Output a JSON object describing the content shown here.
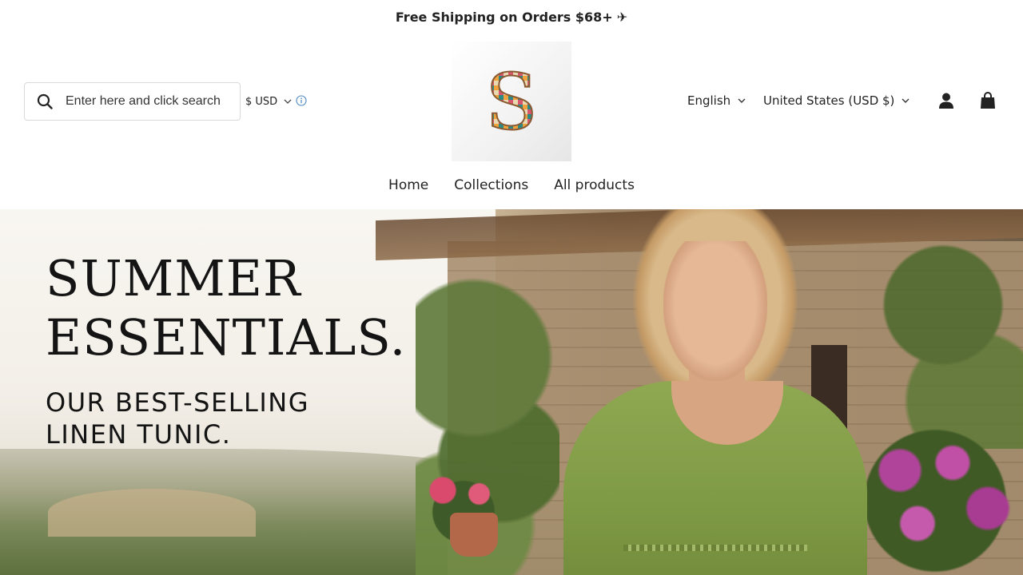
{
  "announcement": {
    "text": "Free Shipping on Orders $68+",
    "icon": "airplane-icon",
    "glyph": "✈"
  },
  "search": {
    "placeholder": "Enter here and click search",
    "value": ""
  },
  "currency": {
    "label": "$ USD"
  },
  "logo": {
    "letter": "S"
  },
  "language": {
    "label": "English"
  },
  "country": {
    "label": "United States (USD $)"
  },
  "nav": {
    "items": [
      {
        "label": "Home"
      },
      {
        "label": "Collections"
      },
      {
        "label": "All products"
      }
    ]
  },
  "hero": {
    "title_line1": "SUMMER",
    "title_line2": "ESSENTIALS.",
    "subtitle_line1": "OUR BEST-SELLING",
    "subtitle_line2": "LINEN TUNIC."
  },
  "icons": {
    "search": "search-icon",
    "chevron": "chevron-down-icon",
    "info": "info-icon",
    "account": "account-icon",
    "cart": "shopping-bag-icon"
  },
  "colors": {
    "text": "#222222",
    "info_icon": "#4a86c5",
    "tunic": "#8fa852"
  }
}
